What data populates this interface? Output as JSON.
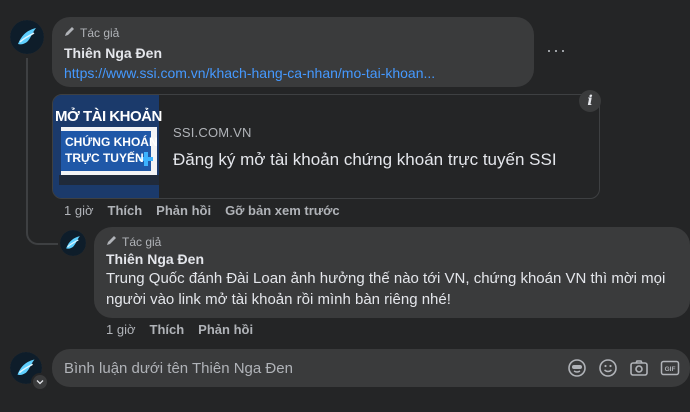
{
  "comment1": {
    "badge": "Tác giả",
    "author": "Thiên Nga Đen",
    "link": "https://www.ssi.com.vn/khach-hang-ca-nhan/mo-tai-khoan...",
    "preview": {
      "thumb_line1": "MỞ TÀI KHOẢN",
      "thumb_line2": "CHỨNG KHOÁN",
      "thumb_line3": "TRỰC TUYẾN",
      "domain": "SSI.COM.VN",
      "title": "Đăng ký mở tài khoản chứng khoán trực tuyến SSI"
    },
    "actions": {
      "time": "1 giờ",
      "like": "Thích",
      "reply": "Phản hồi",
      "remove_preview": "Gỡ bản xem trước"
    }
  },
  "comment2": {
    "badge": "Tác giả",
    "author": "Thiên Nga Đen",
    "text": "Trung Quốc đánh Đài Loan ảnh hưởng thế nào tới VN, chứng khoán VN thì mời mọi người vào link mở tài khoản rồi mình bàn riêng nhé!",
    "actions": {
      "time": "1 giờ",
      "like": "Thích",
      "reply": "Phản hồi"
    }
  },
  "composer": {
    "placeholder": "Bình luận dưới tên Thiên Nga Đen",
    "tools": [
      "avatar-sticker-icon",
      "emoji-icon",
      "camera-icon",
      "gif-icon"
    ]
  },
  "colors": {
    "background": "#242526",
    "bubble": "#3a3b3c",
    "link": "#4599ff",
    "muted": "#b0b3b8"
  }
}
